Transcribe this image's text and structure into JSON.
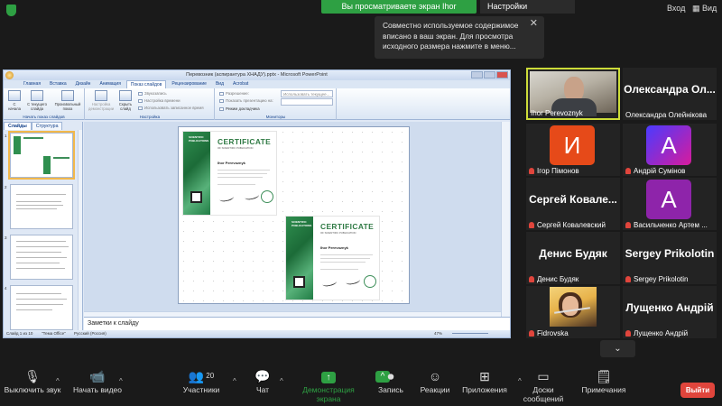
{
  "topbar": {
    "share_label": "Вы просматриваете экран Ihor Perevoznyk",
    "view_options": "Настройки просмотра",
    "enter": "Вход",
    "view": "Вид"
  },
  "notice": {
    "text": "Совместно используемое содержимое вписано в ваш экран. Для просмотра исходного размера нажмите в меню..."
  },
  "ppt": {
    "title": "Перевозник (аспирантура ХНАДУ).pptx - Microsoft PowerPoint",
    "tabs": [
      "Главная",
      "Вставка",
      "Дизайн",
      "Анимация",
      "Показ слайдов",
      "Рецензирование",
      "Вид",
      "Acrobat"
    ],
    "ribbon": {
      "btn_start": "С начала",
      "btn_current": "С текущего слайда",
      "btn_custom": "Произвольный показ",
      "btn_setup": "Настройка демонстрации",
      "btn_hide": "Скрыть слайд",
      "opt_record": "Звукозапись",
      "opt_timing": "Настройка времени",
      "opt_use_timing": "Использовать записанное время",
      "opt_resolution": "Разрешение:",
      "resolution_value": "Использовать текущее...",
      "opt_show_on": "Показать презентацию на:",
      "opt_presenter": "Режим докладчика",
      "group_start": "Начать показ слайдов",
      "group_setup": "Настройка",
      "group_monitors": "Мониторы"
    },
    "thumb_tabs": [
      "Слайды",
      "Структура"
    ],
    "thumb_numbers": [
      "1",
      "2",
      "3",
      "4"
    ],
    "cert": {
      "title": "CERTIFICATE",
      "sub": "OF SCIENTIFIC PUBLICATION",
      "name": "Ihor Perevoznyk",
      "logo": "SCIENTIFIC PUBLICATIONS"
    },
    "notes_placeholder": "Заметки к слайду",
    "status": {
      "slide": "Слайд 1 из 10",
      "theme": "\"Тема Office\"",
      "lang": "Русский (Россия)",
      "zoom": "47%"
    }
  },
  "participants": [
    {
      "name": "Ihor Perevoznyk",
      "type": "video",
      "muted": false
    },
    {
      "name": "Олександра Олейнікова",
      "display": "Олександра Ол...",
      "type": "name",
      "muted": false
    },
    {
      "name": "Ігор Пімонов",
      "type": "avatar",
      "letter": "И",
      "color": "#e64a19",
      "muted": true
    },
    {
      "name": "Андрій Сумінов",
      "type": "avatar",
      "letter": "A",
      "color": "#7b1fa2",
      "muted": true
    },
    {
      "name": "Сергей Ковалевский",
      "display": "Сергей Ковале...",
      "type": "name",
      "muted": true
    },
    {
      "name": "Васильченко Артем ...",
      "type": "avatar",
      "letter": "A",
      "color": "#8e24aa",
      "muted": true
    },
    {
      "name": "Денис Будяк",
      "display": "Денис Будяк",
      "type": "name",
      "muted": true
    },
    {
      "name": "Sergey Prikolotin",
      "display": "Sergey Prikolotin",
      "type": "name",
      "muted": true
    },
    {
      "name": "Fidrovska",
      "type": "video2",
      "muted": true
    },
    {
      "name": "Лущенко Андрій",
      "display": "Лущенко Андрій",
      "type": "name",
      "muted": true
    }
  ],
  "toolbar": {
    "mute": "Выключить звук",
    "video": "Начать видео",
    "participants": "Участники",
    "participants_count": "20",
    "chat": "Чат",
    "share": "Демонстрация экрана",
    "record": "Запись",
    "reactions": "Реакции",
    "apps": "Приложения",
    "whiteboards": "Доски сообщений",
    "notes": "Примечания",
    "leave": "Выйти"
  },
  "colors": {
    "accent_green": "#2ea043",
    "leave_red": "#e0453c",
    "speaker_border": "#cddc39"
  }
}
